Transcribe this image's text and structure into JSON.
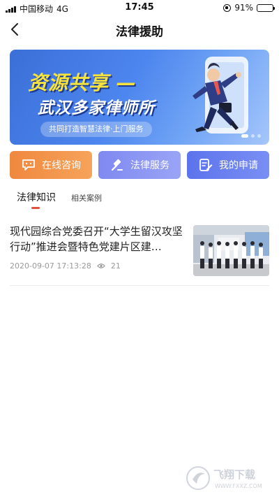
{
  "status_bar": {
    "carrier": "中国移动",
    "network": "4G",
    "time": "17:45",
    "battery": "91%",
    "battery_level": 0.91
  },
  "nav": {
    "title": "法律援助"
  },
  "banner": {
    "title_line1": "资源共享 —",
    "title_line2": "武汉多家律师所",
    "subtitle": "共同打造智慧法律·上门服务"
  },
  "quick_actions": {
    "consult": "在线咨询",
    "service": "法律服务",
    "apply": "我的申请"
  },
  "tabs": {
    "knowledge": "法律知识",
    "cases": "相关案例"
  },
  "article": {
    "title": "现代园综合党委召开“大学生留汉攻坚行动”推进会暨特色党建片区建…",
    "datetime": "2020-09-07 17:13:28",
    "views": "21"
  },
  "watermark": {
    "text": "飞翔下载",
    "url": "WWW.FXXZ.COM"
  },
  "colors": {
    "accent": "#e0523d",
    "consult": "#f0883f",
    "service": "#8a94f3",
    "apply": "#6580ef",
    "banner": "#4d86ee"
  }
}
